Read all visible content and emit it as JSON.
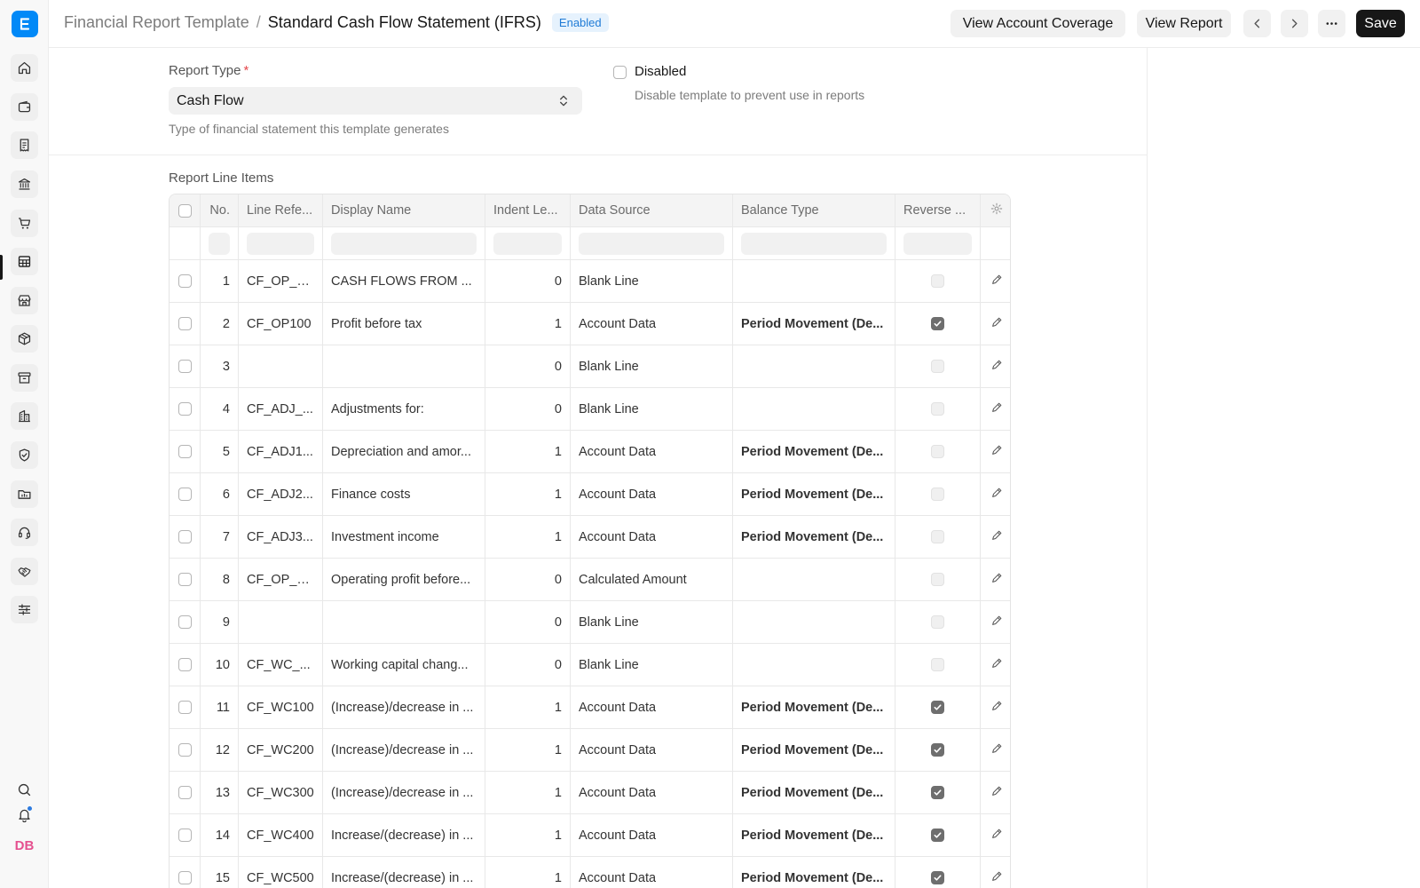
{
  "header": {
    "breadcrumb_parent": "Financial Report Template",
    "breadcrumb_separator": "/",
    "title": "Standard Cash Flow Statement (IFRS)",
    "status_badge": "Enabled",
    "buttons": {
      "view_account_coverage": "View Account Coverage",
      "view_report": "View Report",
      "save": "Save"
    }
  },
  "sidebar": {
    "logo_letter": "E",
    "items": [
      "home-icon",
      "wallet-icon",
      "receipt-icon",
      "bank-icon",
      "cart-icon",
      "table-icon",
      "store-icon",
      "package-icon",
      "archive-icon",
      "building-icon",
      "shield-icon",
      "folder-icon",
      "headset-icon",
      "handshake-icon",
      "sliders-icon"
    ],
    "active_item": "table-icon",
    "avatar_initials": "DB"
  },
  "form": {
    "report_type_label": "Report Type",
    "required_mark": "*",
    "report_type_value": "Cash Flow",
    "report_type_help": "Type of financial statement this template generates",
    "disabled_label": "Disabled",
    "disabled_help": "Disable template to prevent use in reports"
  },
  "table": {
    "title": "Report Line Items",
    "columns": [
      "No.",
      "Line Refe...",
      "Display Name",
      "Indent Le...",
      "Data Source",
      "Balance Type",
      "Reverse ..."
    ],
    "rows": [
      {
        "no": "1",
        "ref": "CF_OP_H...",
        "name": "CASH FLOWS FROM ...",
        "indent": "0",
        "source": "Blank Line",
        "balance": "",
        "reverse": false
      },
      {
        "no": "2",
        "ref": "CF_OP100",
        "name": "Profit before tax",
        "indent": "1",
        "source": "Account Data",
        "balance": "Period Movement (De...",
        "reverse": true
      },
      {
        "no": "3",
        "ref": "",
        "name": "",
        "indent": "0",
        "source": "Blank Line",
        "balance": "",
        "reverse": false
      },
      {
        "no": "4",
        "ref": "CF_ADJ_...",
        "name": "Adjustments for:",
        "indent": "0",
        "source": "Blank Line",
        "balance": "",
        "reverse": false
      },
      {
        "no": "5",
        "ref": "CF_ADJ1...",
        "name": "Depreciation and amor...",
        "indent": "1",
        "source": "Account Data",
        "balance": "Period Movement (De...",
        "reverse": false
      },
      {
        "no": "6",
        "ref": "CF_ADJ2...",
        "name": "Finance costs",
        "indent": "1",
        "source": "Account Data",
        "balance": "Period Movement (De...",
        "reverse": false
      },
      {
        "no": "7",
        "ref": "CF_ADJ3...",
        "name": "Investment income",
        "indent": "1",
        "source": "Account Data",
        "balance": "Period Movement (De...",
        "reverse": false
      },
      {
        "no": "8",
        "ref": "CF_OP_B...",
        "name": "Operating profit before...",
        "indent": "0",
        "source": "Calculated Amount",
        "balance": "",
        "reverse": false
      },
      {
        "no": "9",
        "ref": "",
        "name": "",
        "indent": "0",
        "source": "Blank Line",
        "balance": "",
        "reverse": false
      },
      {
        "no": "10",
        "ref": "CF_WC_...",
        "name": "Working capital chang...",
        "indent": "0",
        "source": "Blank Line",
        "balance": "",
        "reverse": false
      },
      {
        "no": "11",
        "ref": "CF_WC100",
        "name": "(Increase)/decrease in ...",
        "indent": "1",
        "source": "Account Data",
        "balance": "Period Movement (De...",
        "reverse": true
      },
      {
        "no": "12",
        "ref": "CF_WC200",
        "name": "(Increase)/decrease in ...",
        "indent": "1",
        "source": "Account Data",
        "balance": "Period Movement (De...",
        "reverse": true
      },
      {
        "no": "13",
        "ref": "CF_WC300",
        "name": "(Increase)/decrease in ...",
        "indent": "1",
        "source": "Account Data",
        "balance": "Period Movement (De...",
        "reverse": true
      },
      {
        "no": "14",
        "ref": "CF_WC400",
        "name": "Increase/(decrease) in ...",
        "indent": "1",
        "source": "Account Data",
        "balance": "Period Movement (De...",
        "reverse": true
      },
      {
        "no": "15",
        "ref": "CF_WC500",
        "name": "Increase/(decrease) in ...",
        "indent": "1",
        "source": "Account Data",
        "balance": "Period Movement (De...",
        "reverse": true
      }
    ]
  },
  "colors": {
    "brand": "#0289f7",
    "badge_bg": "#e6f2fd",
    "badge_text": "#1f7bd6",
    "save_bg": "#171717",
    "avatar": "#e5508f"
  }
}
